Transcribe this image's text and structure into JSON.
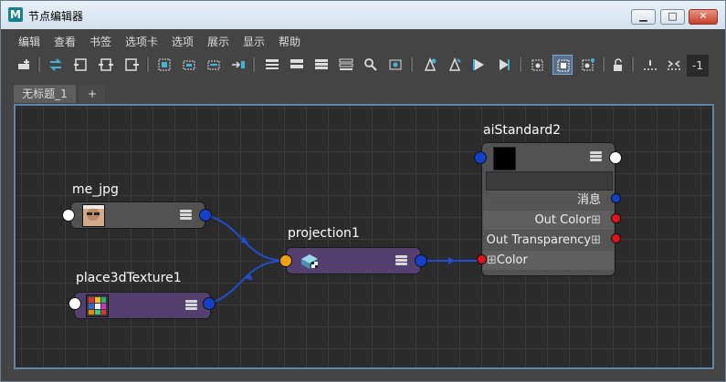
{
  "window": {
    "title": "节点编辑器",
    "app_icon": "M",
    "buttons": {
      "minimize": "▁",
      "maximize": "□",
      "close": "✕"
    }
  },
  "menu": [
    "编辑",
    "查看",
    "书签",
    "选项卡",
    "选项",
    "展示",
    "显示",
    "帮助"
  ],
  "toolbar": {
    "zoom_value": "-1",
    "icons": [
      "add-node-icon",
      "swap-icon",
      "input-frame-icon",
      "io-frame-icon",
      "output-frame-icon",
      "frame-all-icon",
      "graph-add-icon",
      "graph-remove-icon",
      "graph-upstream-icon",
      "layout-simple-icon",
      "layout-connected-icon",
      "layout-all-icon",
      "layout-custom-icon",
      "search-icon",
      "snapshot-icon",
      "pin-add-icon",
      "pin-edit-icon",
      "pin-left-icon",
      "pin-right-icon",
      "render-icon",
      "render-swatch-icon",
      "render-refresh-icon",
      "lock-icon",
      "grid-dots-icon",
      "collapse-icon"
    ]
  },
  "tabs": {
    "active": "无标题_1",
    "add": "+"
  },
  "nodes": {
    "me_jpg": {
      "label": "me_jpg",
      "color": "#525252"
    },
    "place3d": {
      "label": "place3dTexture1",
      "color": "#54406f"
    },
    "projection": {
      "label": "projection1",
      "color": "#54406f"
    },
    "aiStandard": {
      "label": "aiStandard2",
      "color": "#525252",
      "attrs": {
        "message": "消息",
        "out_color": "Out Color",
        "out_transparency": "Out Transparency",
        "color": "Color",
        "expand": "⊞"
      }
    }
  },
  "colors": {
    "port_blue": "#1340c8",
    "port_white": "#ffffff",
    "port_orange": "#f0a011",
    "port_red": "#e0121a",
    "wire_blue": "#1f4fcf",
    "grid_border": "#5d86a8"
  }
}
